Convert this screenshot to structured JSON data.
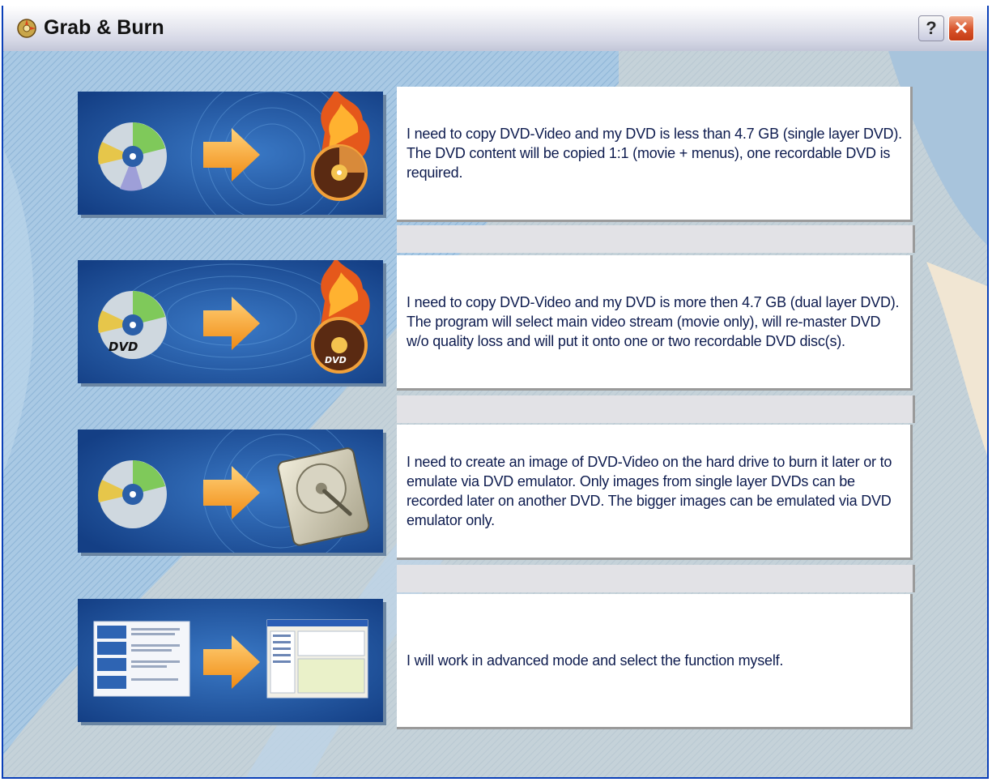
{
  "window": {
    "title": "Grab & Burn",
    "help_label": "?",
    "close_label": "✕"
  },
  "options": [
    {
      "icon": "dvd-copy-single-layer-illustration",
      "text": "I need to copy DVD-Video and my DVD is less than 4.7 GB (single layer DVD). The DVD content will be copied 1:1 (movie + menus), one recordable DVD is required."
    },
    {
      "icon": "dvd-copy-dual-layer-illustration",
      "text": "I need to copy DVD-Video and my DVD is more then 4.7 GB (dual layer DVD). The program will select main video stream (movie only), will re-master DVD w/o quality loss and will put it onto one or two recordable DVD disc(s).",
      "logo_text": "DVD"
    },
    {
      "icon": "dvd-to-hard-drive-illustration",
      "text": "I need to create an image of DVD-Video on the hard drive to burn it later or to emulate via DVD emulator. Only images from single layer DVDs can be recorded later on another DVD. The bigger images can be emulated via DVD emulator only."
    },
    {
      "icon": "advanced-mode-illustration",
      "text": "I will work in advanced mode and select the function myself."
    }
  ],
  "colors": {
    "thumb_blue": "#1e4f9a",
    "arrow_orange": "#f39a2b",
    "text_navy": "#0d1b4e"
  }
}
